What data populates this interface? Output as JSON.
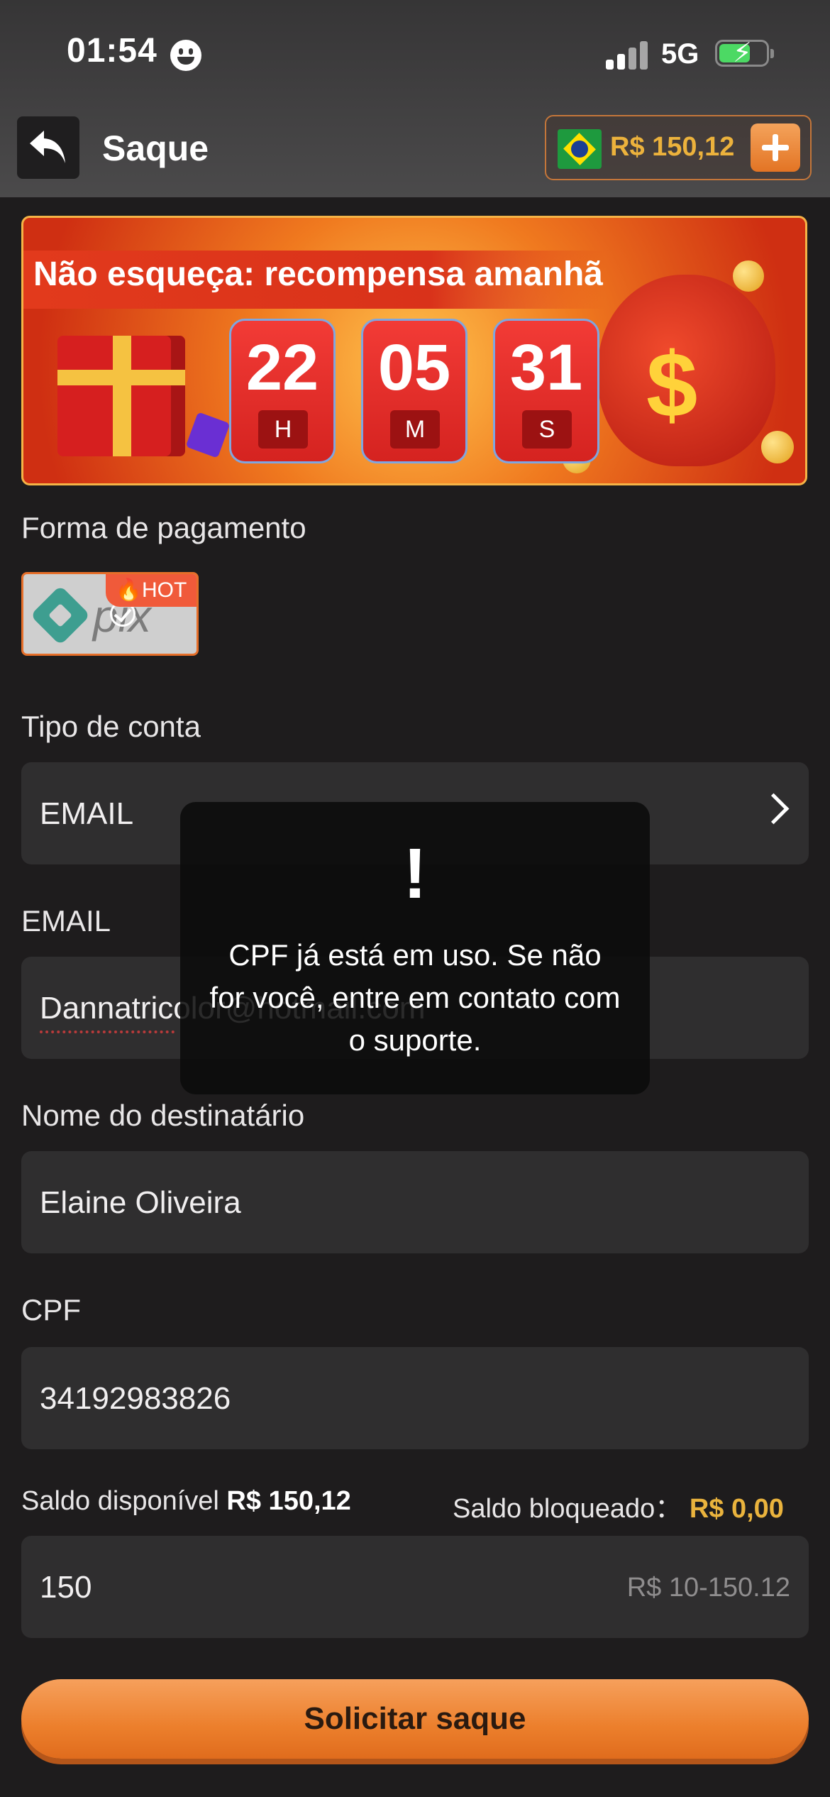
{
  "status_bar": {
    "time": "01:54",
    "network": "5G"
  },
  "header": {
    "title": "Saque",
    "balance": "R$ 150,12"
  },
  "banner": {
    "title": "Não esqueça: recompensa amanhã",
    "timer": [
      {
        "value": "22",
        "unit": "H"
      },
      {
        "value": "05",
        "unit": "M"
      },
      {
        "value": "31",
        "unit": "S"
      }
    ]
  },
  "payment": {
    "label": "Forma de pagamento",
    "method_name": "pix",
    "badge": "HOT"
  },
  "account_type": {
    "label": "Tipo de conta",
    "value": "EMAIL"
  },
  "email": {
    "label": "EMAIL",
    "value": "Dannatricolor@hotmail.com"
  },
  "recipient": {
    "label": "Nome do destinatário",
    "value": "Elaine Oliveira"
  },
  "cpf": {
    "label": "CPF",
    "value": "34192983826"
  },
  "saldo": {
    "available_label": "Saldo disponível",
    "available_value": "R$ 150,12",
    "blocked_label": "Saldo bloqueado：",
    "blocked_value": "R$ 0,00"
  },
  "amount": {
    "value": "150",
    "range_hint": "R$ 10-150.12"
  },
  "submit": {
    "label": "Solicitar saque"
  },
  "toast": {
    "icon": "!",
    "message": "CPF já está em uso. Se não for você, entre em contato com o suporte."
  },
  "colors": {
    "accent": "#ec7f2c",
    "gold": "#eab33d",
    "background": "#1e1c1d"
  }
}
